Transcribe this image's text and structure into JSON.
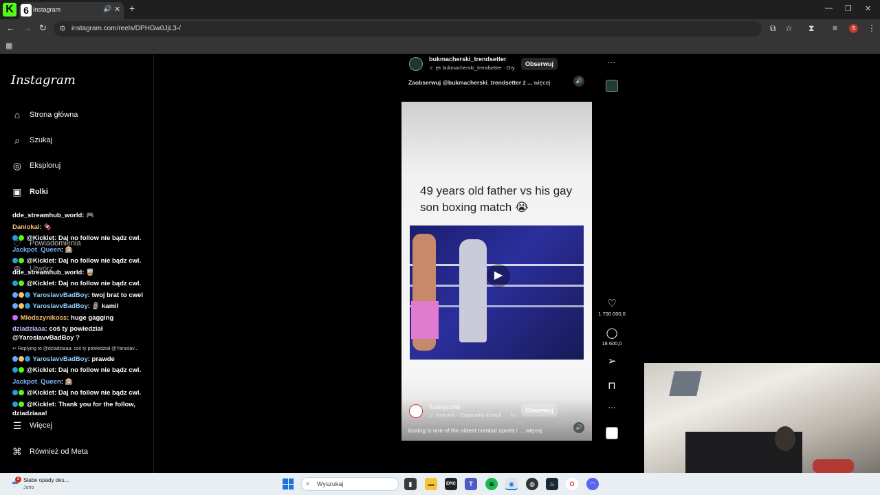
{
  "browser": {
    "tab_title": "Instagram",
    "tab_icon_text": "6",
    "kick_text": "K",
    "url": "instagram.com/reels/DPHGw0JjL3-/",
    "profile_initial": "S"
  },
  "instagram": {
    "logo": "Instagram",
    "nav": [
      {
        "label": "Strona główna",
        "icon": "home-icon",
        "glyph": "⌂"
      },
      {
        "label": "Szukaj",
        "icon": "search-icon",
        "glyph": "⌕"
      },
      {
        "label": "Eksploruj",
        "icon": "compass-icon",
        "glyph": "◎"
      },
      {
        "label": "Rolki",
        "icon": "reels-icon",
        "glyph": "▣"
      },
      {
        "label": "Powiadomienia",
        "icon": "heart-icon",
        "glyph": "♡"
      },
      {
        "label": "Utwórz",
        "icon": "create-icon",
        "glyph": "⊕"
      },
      {
        "label": "Więcej",
        "icon": "menu-icon",
        "glyph": "☰"
      },
      {
        "label": "Również od Meta",
        "icon": "meta-icon",
        "glyph": "⌘"
      }
    ],
    "top_reel": {
      "username": "bukmacherski_trendsetter",
      "audio": "ęk  bukmacherski_trendsetter · Ory",
      "follow": "Obserwuj",
      "caption": "Zaobserwuj @bukmacherski_trendsetter ż ...",
      "more": "więcej"
    },
    "current_reel": {
      "headline": "49 years old father vs his gay son boxing match 😭",
      "username": "funnycuhh",
      "audio": "nnycuhh · Oryginalny dźwięk",
      "audio_suffix": "fu",
      "follow": "Obserwuj",
      "caption": "boxing is one of the oldest combat sports i ...",
      "more": "więcej",
      "likes": "1 700 000,0",
      "comments": "18 600,0"
    }
  },
  "chat": [
    {
      "user": "dde_streamhub_world",
      "msg": "🎮",
      "color": "#ffffff"
    },
    {
      "user": "Daniokai",
      "msg": "🍫",
      "color": "#f6c36b"
    },
    {
      "user": "@Kicklet",
      "msg": "Daj no follow nie bądz cwl.",
      "color": "#ffffff"
    },
    {
      "user": "Jackpot_Queen",
      "msg": "🎰",
      "color": "#7db8ff"
    },
    {
      "user": "@Kicklet",
      "msg": "Daj no follow nie bądz cwl.",
      "color": "#ffffff"
    },
    {
      "user": "dde_streamhub_world",
      "msg": "🥃",
      "color": "#ffffff"
    },
    {
      "user": "@Kicklet",
      "msg": "Daj no follow nie bądz cwl.",
      "color": "#ffffff"
    },
    {
      "user": "YaroslavvBadBoy",
      "msg": "twoj brat to cwel",
      "color": "#8fd3ff"
    },
    {
      "user": "YaroslavvBadBoy",
      "msg": "🗿 kamil",
      "color": "#8fd3ff"
    },
    {
      "user": "Mlodszynikoss",
      "msg": "huge gagging",
      "color": "#f6c36b"
    },
    {
      "user": "dziadziaaa",
      "msg": "coś ty powiedział",
      "color": "#c9b6ff"
    },
    {
      "user": "",
      "msg": "@YaroslavvBadBoy ?",
      "color": "#ffffff"
    },
    {
      "user": "",
      "msg": "Replying to @dziadziaaa: coś ty powiedział @Yaroslav...",
      "color": "#cccccc"
    },
    {
      "user": "YaroslavvBadBoy",
      "msg": "prawde",
      "color": "#8fd3ff"
    },
    {
      "user": "@Kicklet",
      "msg": "Daj no follow nie bądz cwl.",
      "color": "#ffffff"
    },
    {
      "user": "Jackpot_Queen",
      "msg": "🎰",
      "color": "#7db8ff"
    },
    {
      "user": "@Kicklet",
      "msg": "Daj no follow nie bądz cwl.",
      "color": "#ffffff"
    },
    {
      "user": "@Kicklet",
      "msg": "Thank you for the follow,",
      "color": "#ffffff"
    },
    {
      "user": "",
      "msg": "dziadziaaa!",
      "color": "#ffffff"
    }
  ],
  "taskbar": {
    "weather_line1": "Słabe opady des...",
    "weather_line2": "Jutro",
    "weather_badge": "3",
    "search_placeholder": "Wyszukaj"
  }
}
